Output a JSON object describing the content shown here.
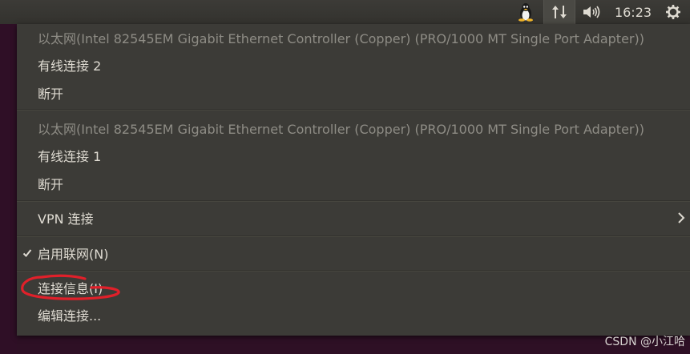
{
  "panel": {
    "clock": "16:23",
    "icons": [
      "tux-icon",
      "network-icon",
      "volume-icon",
      "gear-icon"
    ]
  },
  "menu": {
    "ethernet1": {
      "header": "以太网(Intel 82545EM Gigabit Ethernet Controller (Copper) (PRO/1000 MT Single Port Adapter))",
      "connection": "有线连接 2",
      "disconnect": "断开"
    },
    "ethernet2": {
      "header": "以太网(Intel 82545EM Gigabit Ethernet Controller (Copper) (PRO/1000 MT Single Port Adapter))",
      "connection": "有线连接 1",
      "disconnect": "断开"
    },
    "vpn": "VPN 连接",
    "enable_networking": "启用联网(N)",
    "connection_info": "连接信息(I)",
    "edit_connections": "编辑连接..."
  },
  "watermark": "CSDN @小江哈",
  "colors": {
    "menu_bg": "#3c3b37",
    "text": "#dfdbd2",
    "disabled_text": "#8e8c85",
    "annotation": "#e0202a"
  }
}
